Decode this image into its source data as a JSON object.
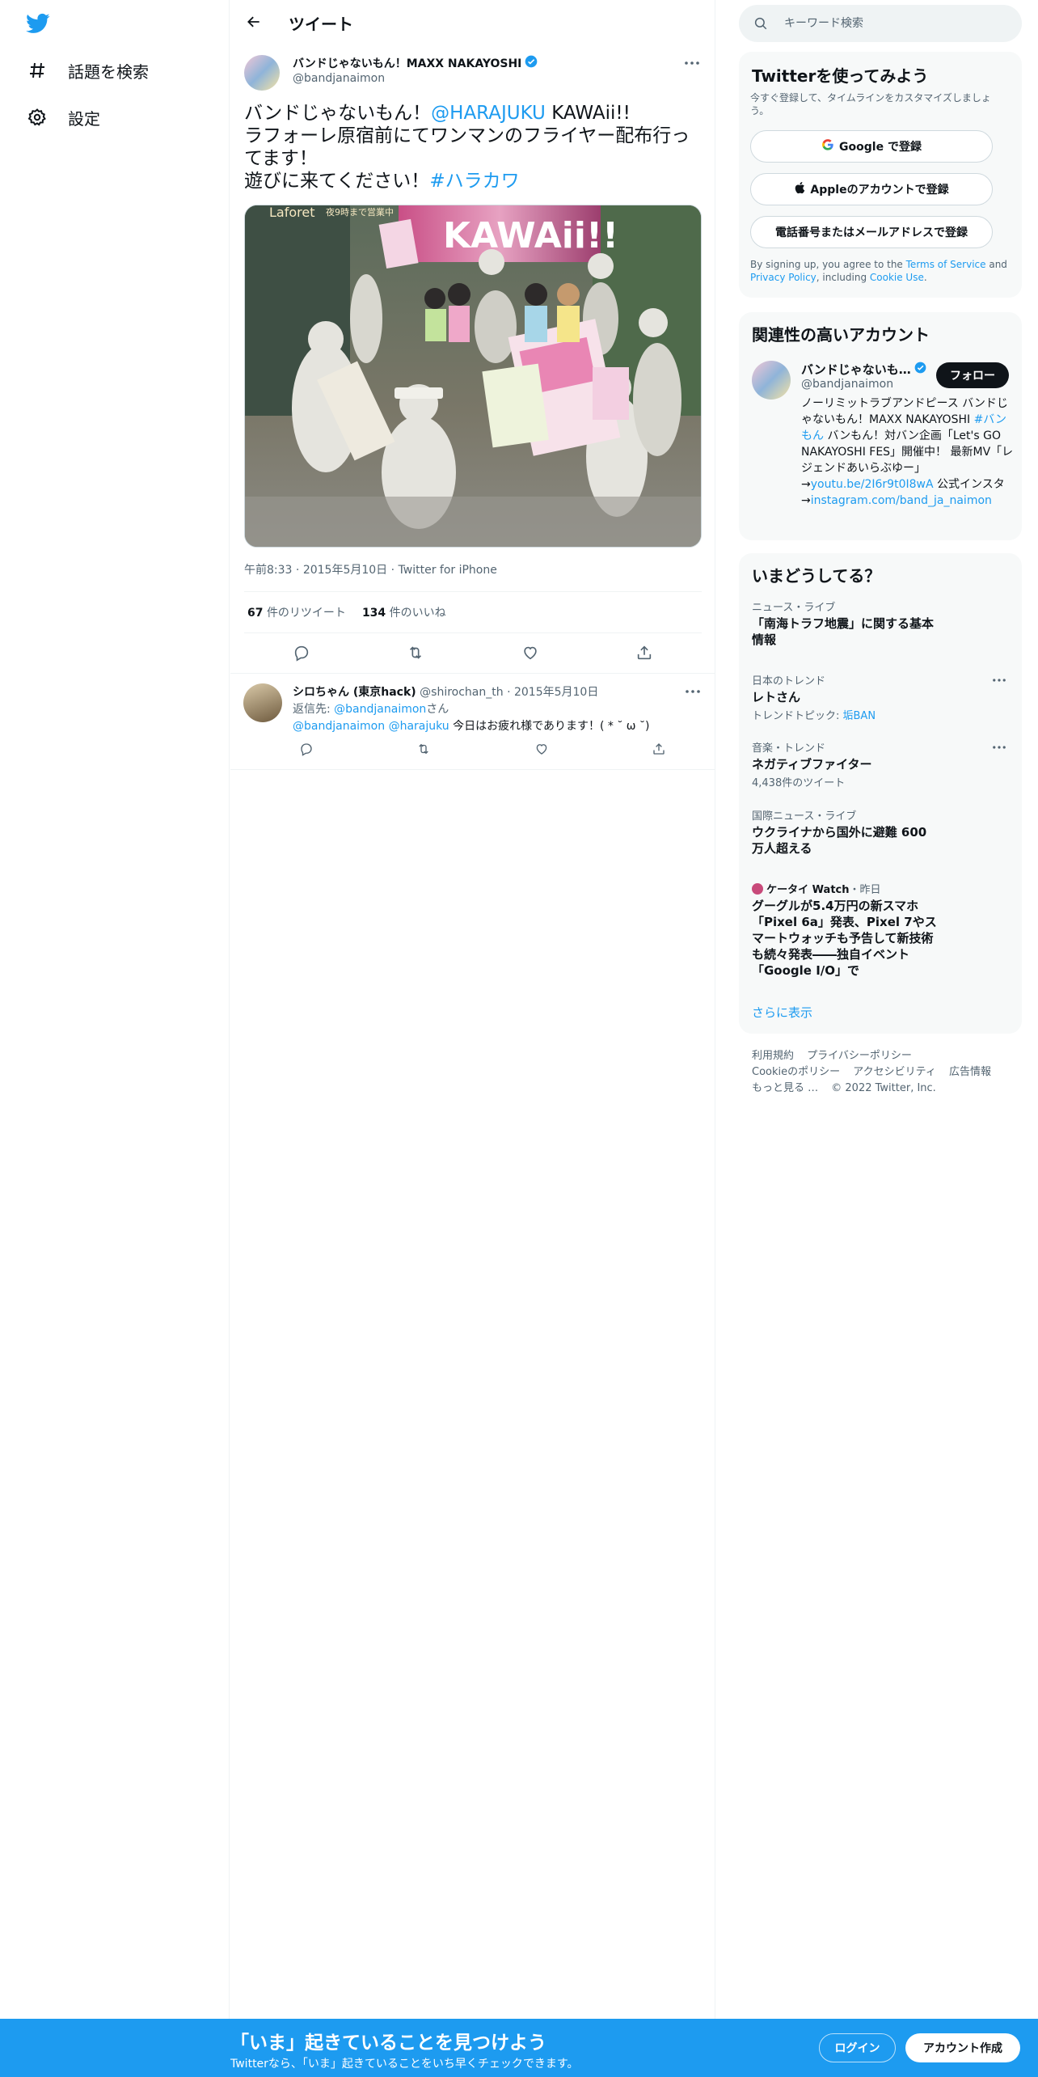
{
  "nav": {
    "items": [
      {
        "label": "話題を検索",
        "icon": "hashtag-icon"
      },
      {
        "label": "設定",
        "icon": "gear-icon"
      }
    ]
  },
  "header": {
    "title": "ツイート"
  },
  "tweet": {
    "author_name": "バンドじゃないもん！MAXX NAKAYOSHI",
    "author_handle": "@bandjanaimon",
    "text": {
      "line1_prefix": "バンドじゃないもん！",
      "line1_mention": "@HARAJUKU",
      "line1_suffix": " KAWAii!!",
      "line2": "ラフォーレ原宿前にてワンマンのフライヤー配布行ってます！",
      "line3_prefix": "遊びに来てください！",
      "line3_hashtag": "#ハラカワ"
    },
    "media": {
      "banner": "KAWAii!!",
      "sign_left": "Laforet",
      "sign_right": "夜9時まで営業中"
    },
    "time": "午前8:33",
    "date": "2015年5月10日",
    "source": "Twitter for iPhone",
    "retweets": "67",
    "retweets_label": "件のリツイート",
    "likes": "134",
    "likes_label": "件のいいね"
  },
  "reply": {
    "name": "シロちゃん (東京hack)",
    "handle": "@shirochan_th",
    "date": "2015年5月10日",
    "reply_to_label": "返信先: ",
    "reply_to_handle": "@bandjanaimon",
    "reply_to_suffix": "さん",
    "mention1": "@bandjanaimon",
    "mention2": "@harajuku",
    "text": " 今日はお疲れ様であります！( * ˘ ω ˘)"
  },
  "search": {
    "placeholder": "キーワード検索"
  },
  "signup_card": {
    "title": "Twitterを使ってみよう",
    "desc": "今すぐ登録して、タイムラインをカスタマイズしましょう。",
    "google": "Google で登録",
    "apple": "Appleのアカウントで登録",
    "phone": "電話番号またはメールアドレスで登録",
    "terms_1": "By signing up, you agree to the ",
    "terms_tos": "Terms of Service",
    "terms_2": " and ",
    "terms_privacy": "Privacy Policy",
    "terms_3": ", including ",
    "terms_cookie": "Cookie Use",
    "terms_4": "."
  },
  "related": {
    "title": "関連性の高いアカウント",
    "name": "バンドじゃないも…",
    "handle": "@bandjanaimon",
    "follow": "フォロー",
    "bio_1": "ノーリミットラブアンドピース バンドじゃないもん！MAXX NAKAYOSHI ",
    "bio_tag": "#バンもん",
    "bio_2": " バンもん！対バン企画「Let's GO NAKAYOSHI FES」開催中！ 最新MV「レジェンドあいらぶゆー」→",
    "bio_link1": "youtu.be/2I6r9t0I8wA",
    "bio_3": " 公式インスタ→",
    "bio_link2": "instagram.com/band_ja_naimon"
  },
  "trends": {
    "title": "いまどうしてる？",
    "items": [
      {
        "category": "ニュース・ライブ",
        "title": "「南海トラフ地震」に関する基本情報"
      },
      {
        "category": "日本のトレンド",
        "title": "レトさん",
        "sub_prefix": "トレンドトピック: ",
        "sub_link": "垢BAN"
      },
      {
        "category": "音楽・トレンド",
        "title": "ネガティブファイター",
        "sub": "4,438件のツイート"
      },
      {
        "category": "国際ニュース・ライブ",
        "title": "ウクライナから国外に避難 600万人超える"
      },
      {
        "category_source": "ケータイ Watch",
        "category_time": "・昨日",
        "title": "グーグルが5.4万円の新スマホ「Pixel 6a」発表、Pixel 7やスマートウォッチも予告して新技術も続々発表――独自イベント「Google I/O」で"
      }
    ],
    "show_more": "さらに表示"
  },
  "footer": {
    "terms": "利用規約",
    "privacy": "プライバシーポリシー",
    "cookie": "Cookieのポリシー",
    "accessibility": "アクセシビリティ",
    "ads": "広告情報",
    "more": "もっと見る …",
    "copyright": "© 2022 Twitter, Inc."
  },
  "bottom_bar": {
    "title": "「いま」起きていることを見つけよう",
    "sub": "Twitterなら、「いま」起きていることをいち早くチェックできます。",
    "login": "ログイン",
    "signup": "アカウント作成"
  },
  "colors": {
    "accent": "#1d9bf0",
    "text": "#0f1419",
    "secondary": "#536471"
  }
}
